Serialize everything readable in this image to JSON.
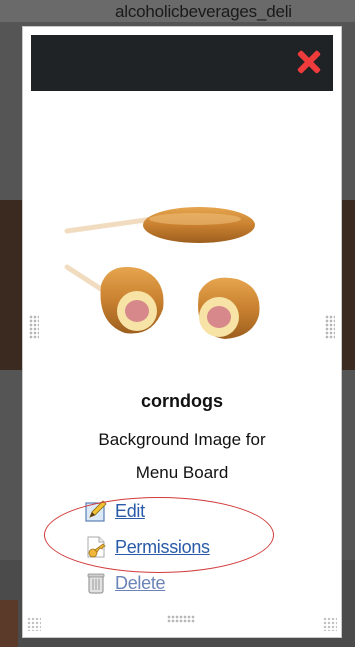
{
  "background": {
    "partial_text": "alcoholicbeverages_deli"
  },
  "modal": {
    "close_icon": "close-x-icon",
    "image_alt": "corndogs",
    "title": "corndogs",
    "description_line1": "Background Image for",
    "description_line2": "Menu Board",
    "actions": [
      {
        "label": "Edit",
        "icon": "edit-pencil-icon"
      },
      {
        "label": "Permissions",
        "icon": "permissions-key-icon"
      },
      {
        "label": "Delete",
        "icon": "trash-icon"
      }
    ]
  },
  "colors": {
    "header": "#1f2326",
    "close": "#ee3b3b",
    "link": "#2a5ba8",
    "highlight": "#d23a3a"
  }
}
